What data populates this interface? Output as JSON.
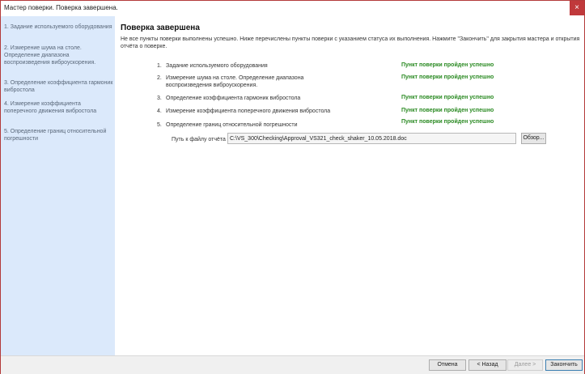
{
  "window": {
    "title": "Мастер поверки. Поверка завершена.",
    "close_glyph": "×"
  },
  "sidebar": {
    "items": [
      {
        "label": "1.  Задание используемого оборудования"
      },
      {
        "label": "2.  Измерение шума на столе. Определение диапазона воспроизведения виброускорения."
      },
      {
        "label": "3.  Определение коэффициента гармоник вибростола"
      },
      {
        "label": "4.  Измерение коэффициента поперечного движения вибростола"
      },
      {
        "label": "5.  Определение границ относительной погрешности"
      }
    ]
  },
  "main": {
    "title": "Поверка завершена",
    "intro": "Не все пункты поверки выполнены успешно. Ниже перечислены пункты поверки с указанием статуса их выполнения. Нажмите \"Закончить\" для закрытия мастера и открытия отчёта о поверке.",
    "steps": [
      {
        "num": "1.",
        "label": "Задание используемого оборудования",
        "status": "Пункт поверки пройден успешно"
      },
      {
        "num": "2.",
        "label": "Измерение шума на столе. Определение диапазона воспроизведения виброускорения.",
        "status": "Пункт поверки пройден успешно"
      },
      {
        "num": "3.",
        "label": "Определение коэффициента гармоник вибростола",
        "status": "Пункт поверки пройден успешно"
      },
      {
        "num": "4.",
        "label": "Измерение коэффициента поперечного движения вибростола",
        "status": "Пункт поверки пройден успешно"
      },
      {
        "num": "5.",
        "label": "Определение границ относительной погрешности",
        "status": "Пункт поверки пройден успешно"
      }
    ],
    "report_path": {
      "label": "Путь к файлу отчёта",
      "value": "C:\\VS_300\\Checking\\Approval_VS321_check_shaker_10.05.2018.doc",
      "browse_label": "Обзор..."
    }
  },
  "footer": {
    "cancel_label": "Отмена",
    "back_label": "< Назад",
    "next_label": "Далее >",
    "finish_label": "Закончить"
  },
  "colors": {
    "accent": "#c0393b",
    "sidebar_bg": "#dbe9fb",
    "success": "#2a8a22"
  }
}
